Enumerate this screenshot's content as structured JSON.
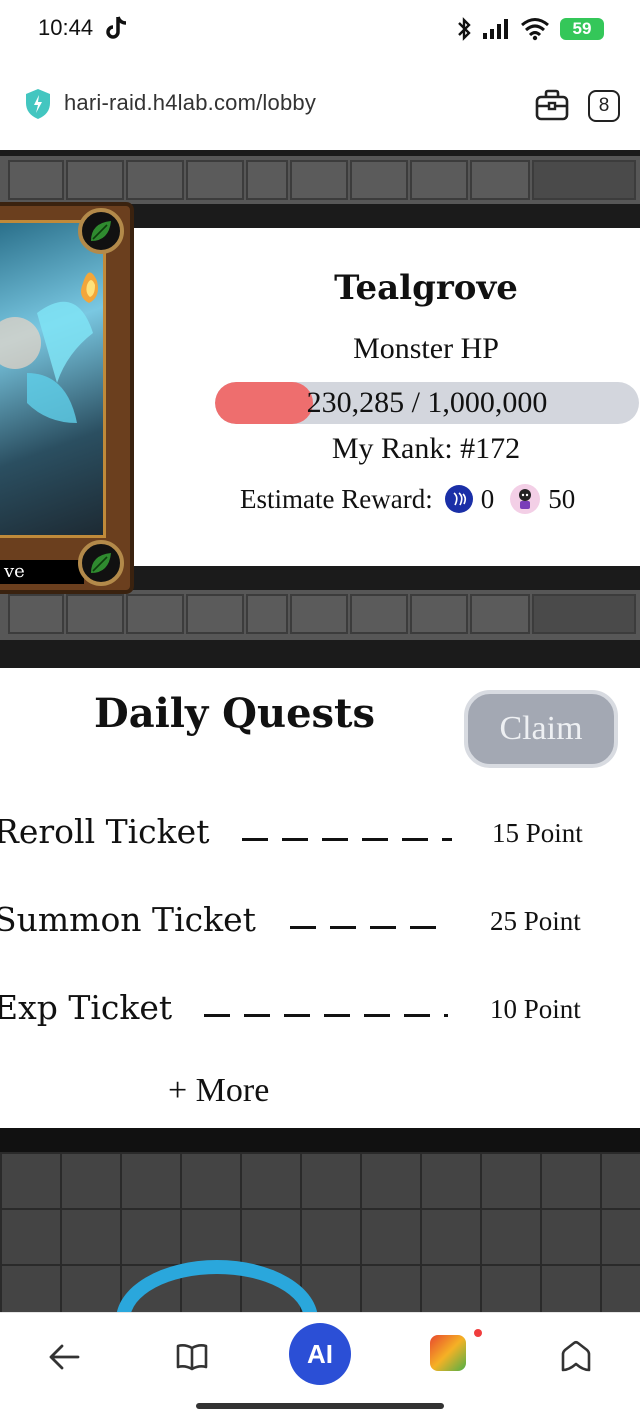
{
  "status_bar": {
    "time": "10:44",
    "battery": "59"
  },
  "browser": {
    "url": "hari-raid.h4lab.com/lobby",
    "tab_count": "8"
  },
  "boss": {
    "card_name": "ve",
    "name": "Tealgrove",
    "hp_label": "Monster HP",
    "hp_text": "230,285 / 1,000,000",
    "hp_current": 230285,
    "hp_max": 1000000,
    "rank_text": "My Rank: #172",
    "reward_label": "Estimate Reward:",
    "reward_steem": "0",
    "reward_pet": "50"
  },
  "quests": {
    "title": "Daily Quests",
    "claim_label": "Claim",
    "items": [
      {
        "name": "Reroll Ticket",
        "points": "15 Point"
      },
      {
        "name": "Summon Ticket",
        "points": "25 Point"
      },
      {
        "name": "Exp Ticket",
        "points": "10 Point"
      }
    ],
    "more_label": "+ More"
  },
  "nav": {
    "ai_label": "AI"
  },
  "colors": {
    "hp_fill": "#ee6e6e",
    "hp_track": "#d3d6dd",
    "claim_bg": "#a3a8b3",
    "ai_blue": "#2b4fd6"
  }
}
